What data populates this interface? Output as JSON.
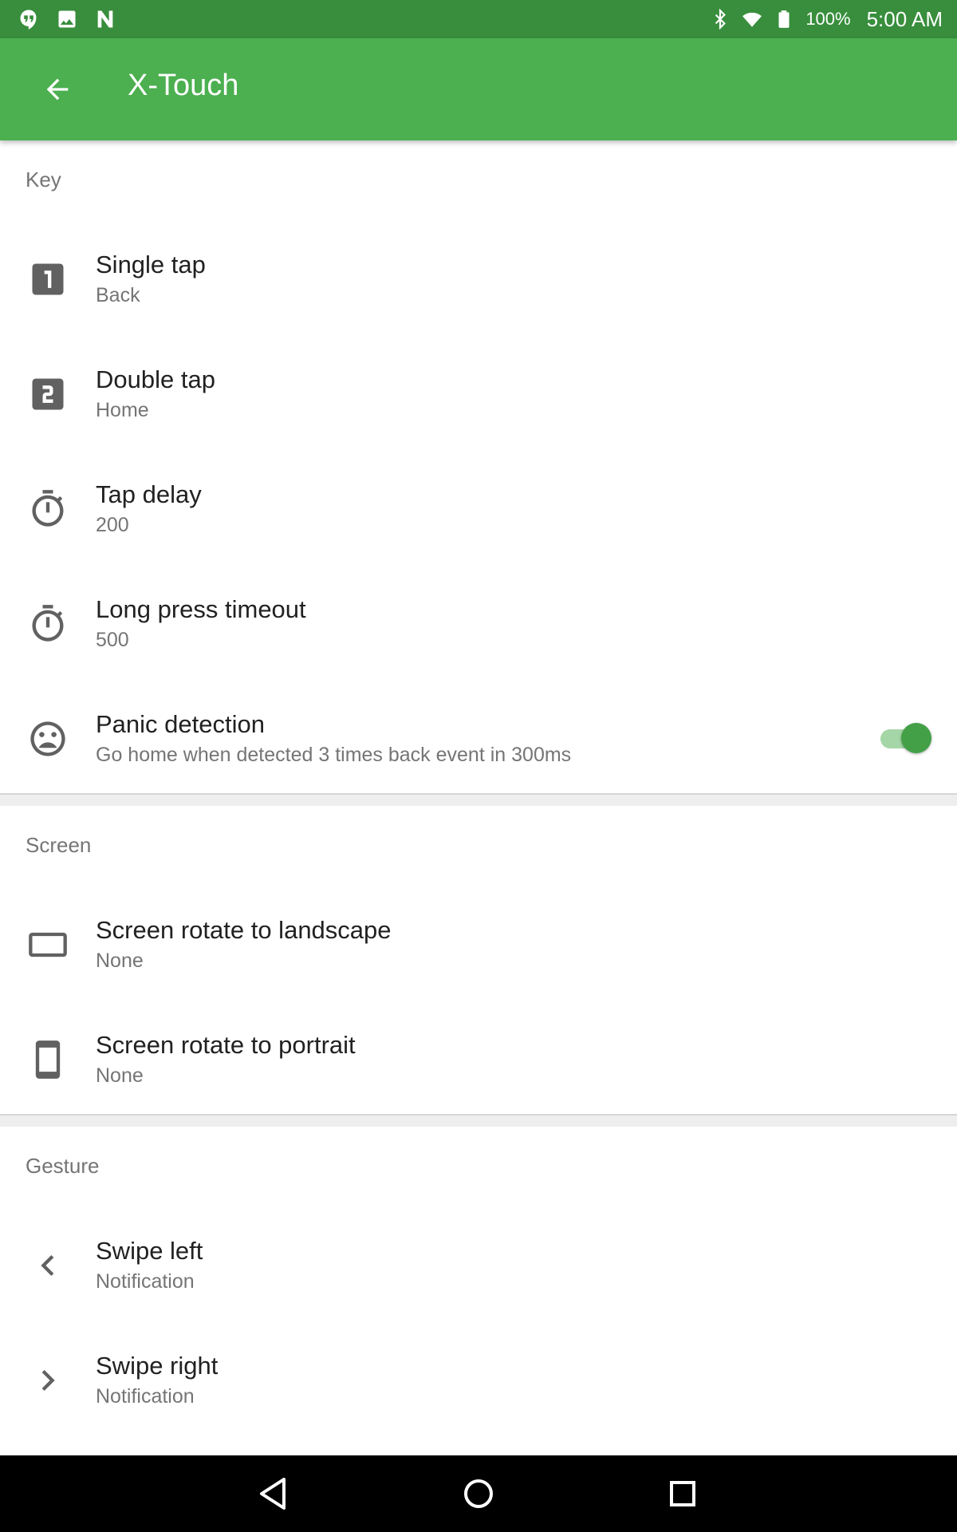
{
  "status_bar": {
    "left_icons": [
      "hangouts-icon",
      "image-icon",
      "n-logo-icon"
    ],
    "right_icons": [
      "bluetooth-icon",
      "wifi-icon",
      "battery-icon"
    ],
    "battery": "100%",
    "time": "5:00 AM"
  },
  "app_bar": {
    "title": "X-Touch",
    "back_icon": "arrow-back-icon"
  },
  "sections": {
    "key": {
      "header": "Key",
      "items": [
        {
          "icon": "looks-one-icon",
          "title": "Single tap",
          "summary": "Back"
        },
        {
          "icon": "looks-two-icon",
          "title": "Double tap",
          "summary": "Home"
        },
        {
          "icon": "timer-icon",
          "title": "Tap delay",
          "summary": "200"
        },
        {
          "icon": "timer-icon",
          "title": "Long press timeout",
          "summary": "500"
        },
        {
          "icon": "sad-face-icon",
          "title": "Panic detection",
          "summary": "Go home when detected 3 times back event in 300ms",
          "toggle_on": true
        }
      ]
    },
    "screen": {
      "header": "Screen",
      "items": [
        {
          "icon": "landscape-icon",
          "title": "Screen rotate to landscape",
          "summary": "None"
        },
        {
          "icon": "portrait-icon",
          "title": "Screen rotate to portrait",
          "summary": "None"
        }
      ]
    },
    "gesture": {
      "header": "Gesture",
      "items": [
        {
          "icon": "chevron-left-icon",
          "title": "Swipe left",
          "summary": "Notification"
        },
        {
          "icon": "chevron-right-icon",
          "title": "Swipe right",
          "summary": "Notification"
        }
      ]
    }
  },
  "nav_bar": {
    "buttons": [
      "back-triangle-icon",
      "home-circle-icon",
      "recents-square-icon"
    ]
  },
  "colors": {
    "status_bar": "#388e3c",
    "app_bar": "#4caf50",
    "toggle_thumb": "#43a047",
    "toggle_track": "#a5d6a7",
    "icon": "#616161"
  }
}
